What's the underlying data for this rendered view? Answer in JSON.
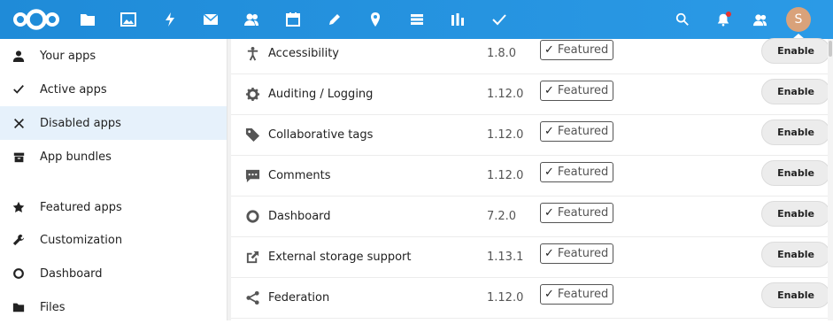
{
  "header": {
    "nav_icons": [
      "files-icon",
      "photos-icon",
      "activity-icon",
      "mail-icon",
      "contacts-icon",
      "calendar-icon",
      "notes-icon",
      "maps-icon",
      "deck-icon",
      "analytics-icon",
      "tasks-icon"
    ],
    "right_icons": [
      "search-icon",
      "notifications-icon",
      "contacts-menu-icon"
    ],
    "avatar_initial": "S",
    "accent": "#1f8bd8"
  },
  "sidebar": {
    "items": [
      {
        "label": "Your apps",
        "icon": "user-icon",
        "active": false
      },
      {
        "label": "Active apps",
        "icon": "check-icon",
        "active": false
      },
      {
        "label": "Disabled apps",
        "icon": "close-icon",
        "active": true
      },
      {
        "label": "App bundles",
        "icon": "archive-icon",
        "active": false
      },
      {
        "label": "Featured apps",
        "icon": "star-icon",
        "active": false
      },
      {
        "label": "Customization",
        "icon": "wrench-icon",
        "active": false
      },
      {
        "label": "Dashboard",
        "icon": "circle-icon",
        "active": false
      },
      {
        "label": "Files",
        "icon": "folder-icon",
        "active": false
      }
    ]
  },
  "apps": [
    {
      "name": "Accessibility",
      "version": "1.8.0",
      "badge": "Featured",
      "action": "Enable",
      "icon": "accessibility-icon"
    },
    {
      "name": "Auditing / Logging",
      "version": "1.12.0",
      "badge": "Featured",
      "action": "Enable",
      "icon": "gear-icon"
    },
    {
      "name": "Collaborative tags",
      "version": "1.12.0",
      "badge": "Featured",
      "action": "Enable",
      "icon": "tag-icon"
    },
    {
      "name": "Comments",
      "version": "1.12.0",
      "badge": "Featured",
      "action": "Enable",
      "icon": "comment-icon"
    },
    {
      "name": "Dashboard",
      "version": "7.2.0",
      "badge": "Featured",
      "action": "Enable",
      "icon": "circle-icon"
    },
    {
      "name": "External storage support",
      "version": "1.13.1",
      "badge": "Featured",
      "action": "Enable",
      "icon": "external-link-icon"
    },
    {
      "name": "Federation",
      "version": "1.12.0",
      "badge": "Featured",
      "action": "Enable",
      "icon": "share-icon"
    }
  ]
}
